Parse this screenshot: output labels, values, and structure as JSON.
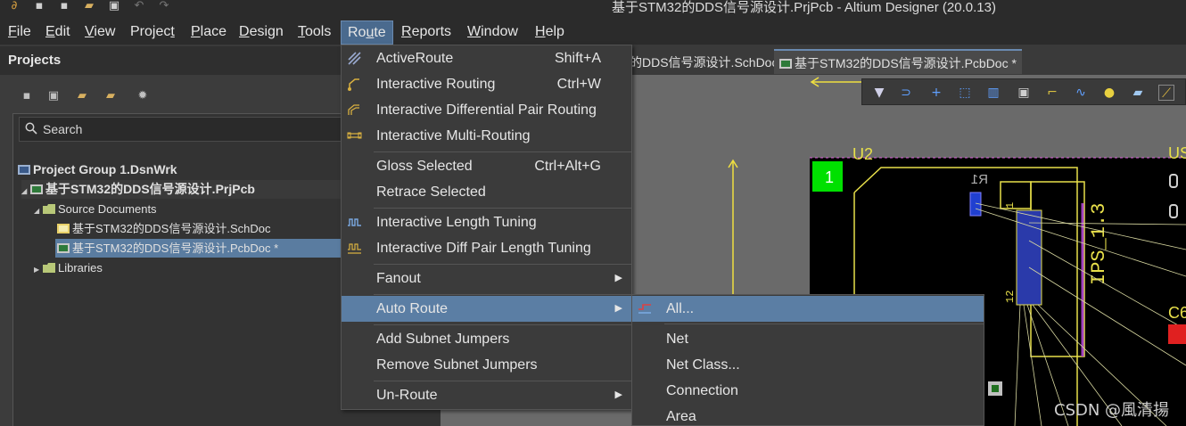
{
  "window": {
    "title": "基于STM32的DDS信号源设计.PrjPcb - Altium Designer (20.0.13)"
  },
  "menubar": {
    "items": [
      {
        "label": "File",
        "u": "F",
        "rest": "ile"
      },
      {
        "label": "Edit",
        "u": "E",
        "rest": "dit"
      },
      {
        "label": "View",
        "u": "V",
        "rest": "iew"
      },
      {
        "label": "Project",
        "pre": "Projec",
        "u": "t",
        "rest": ""
      },
      {
        "label": "Place",
        "u": "P",
        "rest": "lace"
      },
      {
        "label": "Design",
        "u": "D",
        "rest": "esign"
      },
      {
        "label": "Tools",
        "u": "T",
        "rest": "ools"
      },
      {
        "label": "Route",
        "pre": "Ro",
        "u": "u",
        "rest": "te"
      },
      {
        "label": "Reports",
        "u": "R",
        "rest": "eports"
      },
      {
        "label": "Window",
        "u": "W",
        "rest": "indow"
      },
      {
        "label": "Help",
        "u": "H",
        "rest": "elp"
      }
    ]
  },
  "projects_panel": {
    "title": "Projects",
    "search_placeholder": "Search",
    "tree": {
      "group": "Project Group 1.DsnWrk",
      "project": "基于STM32的DDS信号源设计.PrjPcb",
      "source_folder": "Source Documents",
      "schdoc": "基于STM32的DDS信号源设计.SchDoc",
      "pcbdoc": "基于STM32的DDS信号源设计.PcbDoc *",
      "libraries": "Libraries"
    }
  },
  "doc_tabs": {
    "schdoc": "的DDS信号源设计.SchDoc",
    "pcbdoc": "基于STM32的DDS信号源设计.PcbDoc *"
  },
  "route_menu": {
    "items": [
      {
        "label": "ActiveRoute",
        "shortcut": "Shift+A"
      },
      {
        "label": "Interactive Routing",
        "shortcut": "Ctrl+W"
      },
      {
        "label": "Interactive Differential Pair Routing",
        "shortcut": ""
      },
      {
        "label": "Interactive Multi-Routing",
        "shortcut": ""
      },
      {
        "label": "Gloss Selected",
        "shortcut": "Ctrl+Alt+G"
      },
      {
        "label": "Retrace Selected",
        "shortcut": ""
      },
      {
        "label": "Interactive Length Tuning",
        "shortcut": ""
      },
      {
        "label": "Interactive Diff Pair Length Tuning",
        "shortcut": ""
      },
      {
        "label": "Fanout",
        "shortcut": ""
      },
      {
        "label": "Auto Route",
        "shortcut": ""
      },
      {
        "label": "Add Subnet Jumpers",
        "shortcut": ""
      },
      {
        "label": "Remove Subnet Jumpers",
        "shortcut": ""
      },
      {
        "label": "Un-Route",
        "shortcut": ""
      }
    ]
  },
  "auto_route_submenu": {
    "items": [
      {
        "label": "All..."
      },
      {
        "label": "Net"
      },
      {
        "label": "Net Class..."
      },
      {
        "label": "Connection"
      },
      {
        "label": "Area"
      }
    ]
  },
  "pcb": {
    "component_labels": {
      "u2": "U2",
      "r1": "R1",
      "ips": "IPS_1.3",
      "pad1": "1",
      "pin12": "12",
      "pin1": "1",
      "c6": "C6",
      "us": "US"
    }
  },
  "watermark": "CSDN @風清揚",
  "colors": {
    "menu_highlight": "#5b7ea4",
    "pcb_background": "#000000",
    "pad_green": "#00e000",
    "silkscreen_yellow": "#e8e04a"
  }
}
